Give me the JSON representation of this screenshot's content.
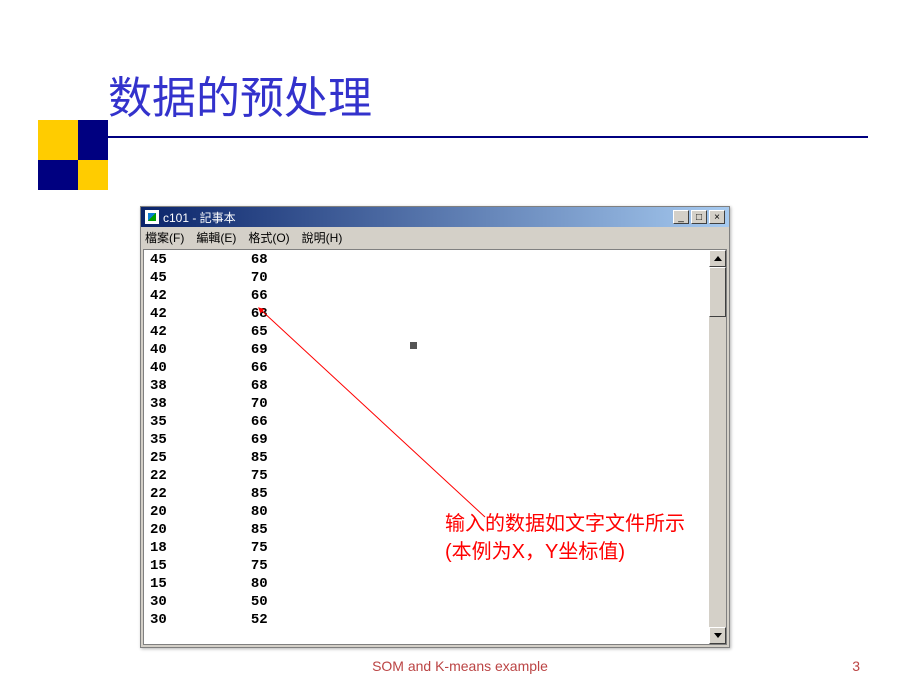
{
  "title": "数据的预处理",
  "notepad": {
    "title": "c101 - 記事本",
    "menu": [
      "檔案(F)",
      "編輯(E)",
      "格式(O)",
      "說明(H)"
    ],
    "window_buttons": {
      "min": "_",
      "max": "□",
      "close": "×"
    },
    "data": [
      [
        45,
        68
      ],
      [
        45,
        70
      ],
      [
        42,
        66
      ],
      [
        42,
        68
      ],
      [
        42,
        65
      ],
      [
        40,
        69
      ],
      [
        40,
        66
      ],
      [
        38,
        68
      ],
      [
        38,
        70
      ],
      [
        35,
        66
      ],
      [
        35,
        69
      ],
      [
        25,
        85
      ],
      [
        22,
        75
      ],
      [
        22,
        85
      ],
      [
        20,
        80
      ],
      [
        20,
        85
      ],
      [
        18,
        75
      ],
      [
        15,
        75
      ],
      [
        15,
        80
      ],
      [
        30,
        50
      ],
      [
        30,
        52
      ]
    ]
  },
  "callout": {
    "line1": "输入的数据如文字文件所示",
    "line2": "(本例为X，Y坐标值)"
  },
  "footer": "SOM and K-means example",
  "page_number": "3",
  "chart_data": {
    "type": "table",
    "description": "Two-column coordinate data shown in Notepad text file c101",
    "columns": [
      "X",
      "Y"
    ],
    "rows": [
      [
        45,
        68
      ],
      [
        45,
        70
      ],
      [
        42,
        66
      ],
      [
        42,
        68
      ],
      [
        42,
        65
      ],
      [
        40,
        69
      ],
      [
        40,
        66
      ],
      [
        38,
        68
      ],
      [
        38,
        70
      ],
      [
        35,
        66
      ],
      [
        35,
        69
      ],
      [
        25,
        85
      ],
      [
        22,
        75
      ],
      [
        22,
        85
      ],
      [
        20,
        80
      ],
      [
        20,
        85
      ],
      [
        18,
        75
      ],
      [
        15,
        75
      ],
      [
        15,
        80
      ],
      [
        30,
        50
      ],
      [
        30,
        52
      ]
    ]
  }
}
